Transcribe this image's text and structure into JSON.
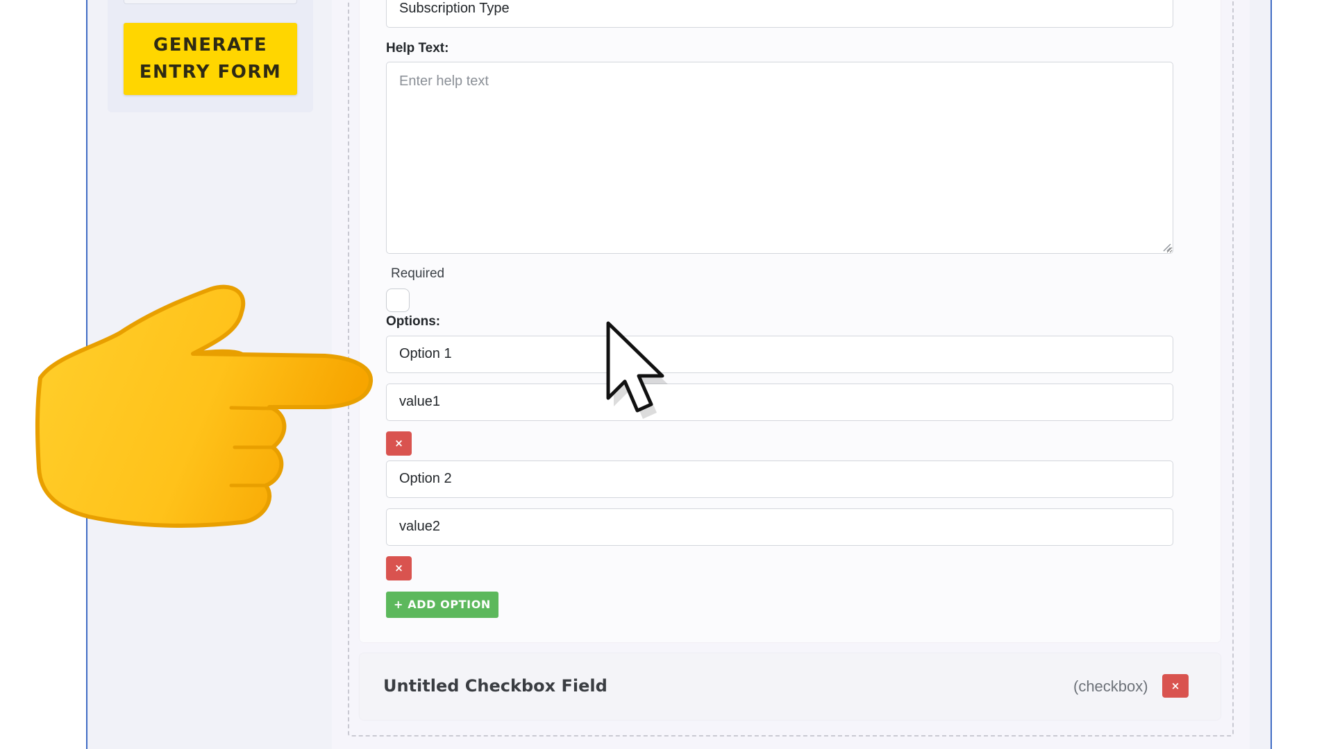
{
  "sidebar": {
    "generate_button_label": "GENERATE\nENTRY FORM"
  },
  "field_editor": {
    "label_value": "Subscription Type",
    "help_text_label": "Help Text:",
    "help_text_placeholder": "Enter help text",
    "help_text_value": "",
    "required_label": "Required",
    "required_checked": false,
    "options_label": "Options:",
    "options": [
      {
        "label": "Option 1",
        "value": "value1",
        "remove_label": "×"
      },
      {
        "label": "Option 2",
        "value": "value2",
        "remove_label": "×"
      }
    ],
    "add_option_label": "+ ADD OPTION"
  },
  "collapsed_field": {
    "title": "Untitled Checkbox Field",
    "type_label": "(checkbox)",
    "remove_label": "×"
  },
  "colors": {
    "generate_button": "#ffd600",
    "remove_button": "#d9534f",
    "add_option_button": "#5cb85c",
    "frame_border": "#3f6bc4"
  },
  "icons": {
    "pointing_hand": "backhand-index-pointing-right-icon",
    "cursor": "mouse-pointer-icon"
  }
}
